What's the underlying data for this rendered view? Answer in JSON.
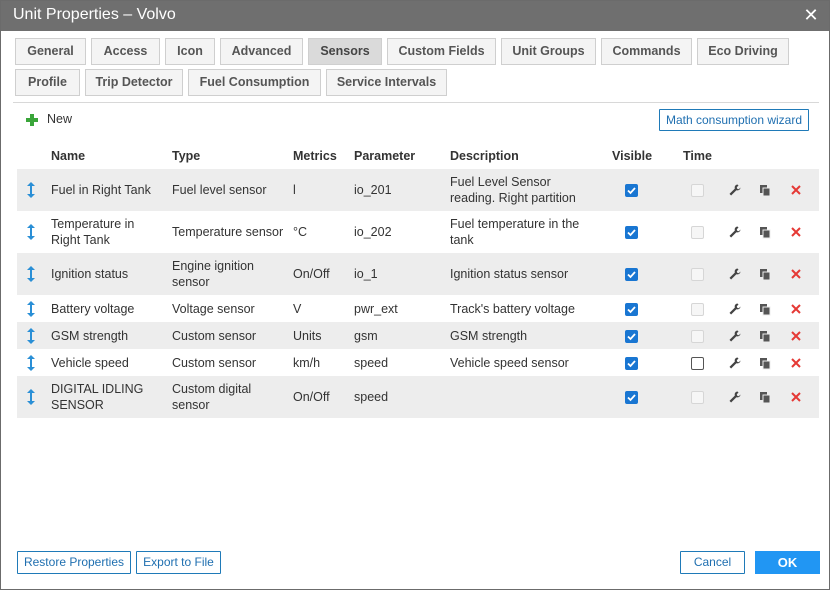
{
  "window": {
    "title": "Unit Properties – Volvo",
    "close_icon": "close-icon"
  },
  "tabs": [
    {
      "label": "General"
    },
    {
      "label": "Access"
    },
    {
      "label": "Icon"
    },
    {
      "label": "Advanced"
    },
    {
      "label": "Sensors"
    },
    {
      "label": "Custom Fields"
    },
    {
      "label": "Unit Groups"
    },
    {
      "label": "Commands"
    },
    {
      "label": "Eco Driving"
    },
    {
      "label": "Profile"
    },
    {
      "label": "Trip Detector"
    },
    {
      "label": "Fuel Consumption"
    },
    {
      "label": "Service Intervals"
    }
  ],
  "active_tab": "Sensors",
  "toolbar": {
    "new_label": "New",
    "wizard_label": "Math consumption wizard"
  },
  "table": {
    "headers": {
      "name": "Name",
      "type": "Type",
      "metrics": "Metrics",
      "parameter": "Parameter",
      "description": "Description",
      "visible": "Visible",
      "time": "Time"
    },
    "rows": [
      {
        "name": [
          "Fuel in Right Tank"
        ],
        "type": [
          "Fuel level sensor"
        ],
        "metrics": "l",
        "parameter": "io_201",
        "description": [
          "Fuel Level Sensor",
          "reading. Right partition"
        ],
        "visible": true,
        "time": "disabled"
      },
      {
        "name": [
          "Temperature in",
          "Right Tank"
        ],
        "type": [
          "Temperature sensor"
        ],
        "metrics": "°C",
        "parameter": "io_202",
        "description": [
          "Fuel temperature in the",
          "tank"
        ],
        "visible": true,
        "time": "disabled"
      },
      {
        "name": [
          "Ignition status"
        ],
        "type": [
          "Engine ignition",
          "sensor"
        ],
        "metrics": "On/Off",
        "parameter": "io_1",
        "description": [
          "Ignition status sensor"
        ],
        "visible": true,
        "time": "disabled"
      },
      {
        "name": [
          "Battery voltage"
        ],
        "type": [
          "Voltage sensor"
        ],
        "metrics": "V",
        "parameter": "pwr_ext",
        "description": [
          "Track's battery voltage"
        ],
        "visible": true,
        "time": "disabled"
      },
      {
        "name": [
          "GSM strength"
        ],
        "type": [
          "Custom sensor"
        ],
        "metrics": "Units",
        "parameter": "gsm",
        "description": [
          "GSM strength"
        ],
        "visible": true,
        "time": "disabled"
      },
      {
        "name": [
          "Vehicle speed"
        ],
        "type": [
          "Custom sensor"
        ],
        "metrics": "km/h",
        "parameter": "speed",
        "description": [
          "Vehicle speed sensor"
        ],
        "visible": true,
        "time": "unchecked"
      },
      {
        "name": [
          "DIGITAL IDLING",
          "SENSOR"
        ],
        "type": [
          "Custom digital",
          "sensor"
        ],
        "metrics": "On/Off",
        "parameter": "speed",
        "description": [],
        "visible": true,
        "time": "disabled"
      }
    ]
  },
  "footer": {
    "restore_label": "Restore Properties",
    "export_label": "Export to File",
    "cancel_label": "Cancel",
    "ok_label": "OK"
  },
  "colors": {
    "ok_button": "#2196f3",
    "titlebar": "#6f6f6f",
    "delete_icon": "#e53935",
    "new_plus": "#3aa53a"
  }
}
